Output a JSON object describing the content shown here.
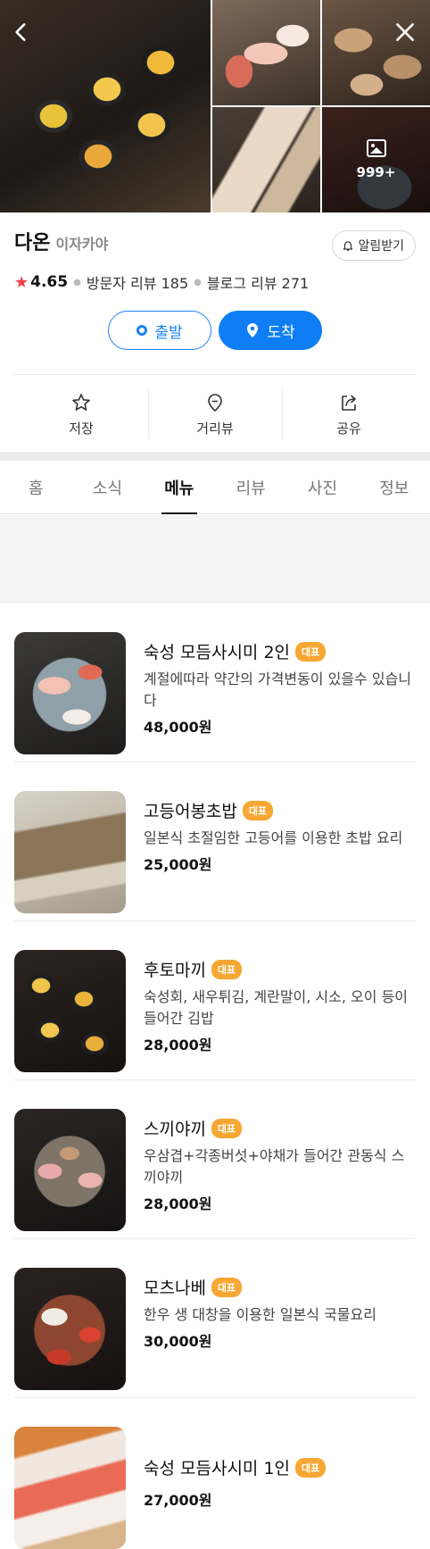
{
  "gallery": {
    "more_count": "999+"
  },
  "place": {
    "name": "다온",
    "category": "이자카야",
    "alert_label": "알림받기",
    "rating_star": "★",
    "rating": "4.65",
    "visitor_reviews_label": "방문자 리뷰",
    "visitor_reviews_count": "185",
    "blog_reviews_label": "블로그 리뷰",
    "blog_reviews_count": "271"
  },
  "route": {
    "depart_label": "출발",
    "arrive_label": "도착"
  },
  "actions": [
    {
      "label": "저장",
      "icon": "star-outline-icon"
    },
    {
      "label": "거리뷰",
      "icon": "location-pin-icon"
    },
    {
      "label": "공유",
      "icon": "share-icon"
    }
  ],
  "tabs": [
    "홈",
    "소식",
    "메뉴",
    "리뷰",
    "사진",
    "정보"
  ],
  "active_tab": "메뉴",
  "menu_badge": "대표",
  "menu": [
    {
      "name": "숙성 모듬사시미 2인",
      "desc": "계절에따라 약간의 가격변동이 있을수 있습니다",
      "price": "48,000원"
    },
    {
      "name": "고등어봉초밥",
      "desc": "일본식 초절임한 고등어를 이용한 초밥 요리",
      "price": "25,000원"
    },
    {
      "name": "후토마끼",
      "desc": "숙성회, 새우튀김, 계란말이, 시소, 오이 등이 들어간 김밥",
      "price": "28,000원"
    },
    {
      "name": "스끼야끼",
      "desc": "우삼겹+각종버섯+야채가 들어간 관동식 스끼야끼",
      "price": "28,000원"
    },
    {
      "name": "모츠나베",
      "desc": "한우 생 대창을 이용한 일본식 국물요리",
      "price": "30,000원"
    },
    {
      "name": "숙성 모듬사시미 1인",
      "desc": "",
      "price": "27,000원"
    }
  ],
  "colors": {
    "primary_blue": "#0f7ef5",
    "rating_star": "#f23c48",
    "badge_orange": "#f7a733"
  }
}
